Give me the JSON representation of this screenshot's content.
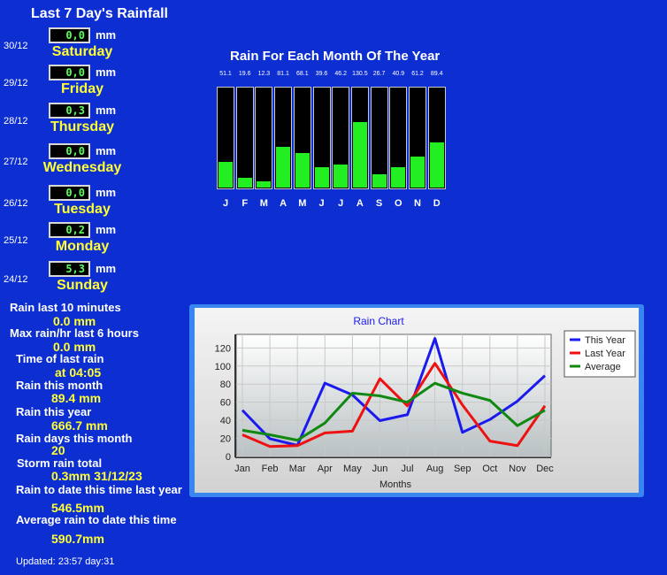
{
  "title": "Last 7 Day's Rainfall",
  "unit": "mm",
  "days": [
    {
      "date": "30/12",
      "value": "0,0",
      "day": "Saturday"
    },
    {
      "date": "29/12",
      "value": "0,0",
      "day": "Friday"
    },
    {
      "date": "28/12",
      "value": "0,3",
      "day": "Thursday"
    },
    {
      "date": "27/12",
      "value": "0,0",
      "day": "Wednesday"
    },
    {
      "date": "26/12",
      "value": "0,0",
      "day": "Tuesday"
    },
    {
      "date": "25/12",
      "value": "0,2",
      "day": "Monday"
    },
    {
      "date": "24/12",
      "value": "5,3",
      "day": "Sunday"
    }
  ],
  "stats": [
    {
      "label": "Rain last 10 minutes",
      "value": "0.0 mm"
    },
    {
      "label": "Max rain/hr last 6 hours",
      "value": "0.0 mm"
    },
    {
      "label": "Time of last rain",
      "value": "at 04:05"
    },
    {
      "label": "Rain this month",
      "value": "89.4 mm"
    },
    {
      "label": "Rain this year",
      "value": "666.7 mm"
    },
    {
      "label": "Rain days this month",
      "value": "20"
    },
    {
      "label": "Storm rain total",
      "value": "0.3mm 31/12/23"
    },
    {
      "label": "Rain to date this time last year",
      "value": "546.5mm"
    },
    {
      "label": "Average rain to date this time",
      "value": "590.7mm"
    }
  ],
  "updated": "Updated: 23:57 day:31",
  "monthly": {
    "title": "Rain For Each Month Of The Year",
    "labels": [
      "J",
      "F",
      "M",
      "A",
      "M",
      "J",
      "J",
      "A",
      "S",
      "O",
      "N",
      "D"
    ],
    "value_labels": [
      "51.1",
      "19.6",
      "12.3",
      "81.1",
      "68.1",
      "39.6",
      "46.2",
      "130.5",
      "26.7",
      "40.9",
      "61.2",
      "89.4"
    ],
    "values": [
      51.1,
      19.6,
      12.3,
      81.1,
      68.1,
      39.6,
      46.2,
      130.5,
      26.7,
      40.9,
      61.2,
      89.4
    ],
    "max": 200,
    "bar_color": "#22ee22"
  },
  "chart_data": {
    "type": "line",
    "title": "Rain Chart",
    "xlabel": "Months",
    "ylabel": "",
    "categories": [
      "Jan",
      "Feb",
      "Mar",
      "Apr",
      "May",
      "Jun",
      "Jul",
      "Aug",
      "Sep",
      "Oct",
      "Nov",
      "Dec"
    ],
    "yticks": [
      0,
      20,
      40,
      60,
      80,
      100,
      120
    ],
    "ylim": [
      0,
      135
    ],
    "grid": true,
    "legend": "top-right",
    "series": [
      {
        "name": "This Year",
        "color": "#1a1aee",
        "values": [
          51.1,
          19.6,
          12.3,
          81.1,
          68.1,
          39.6,
          46.2,
          130.5,
          26.7,
          40.9,
          61.2,
          89.4
        ]
      },
      {
        "name": "Last Year",
        "color": "#ee1111",
        "values": [
          24,
          11,
          12,
          26,
          28,
          86,
          56,
          103,
          57,
          17,
          12,
          56
        ]
      },
      {
        "name": "Average",
        "color": "#118811",
        "values": [
          29,
          24,
          18,
          37,
          70,
          67,
          60,
          81,
          70,
          62,
          34,
          51
        ]
      }
    ]
  }
}
